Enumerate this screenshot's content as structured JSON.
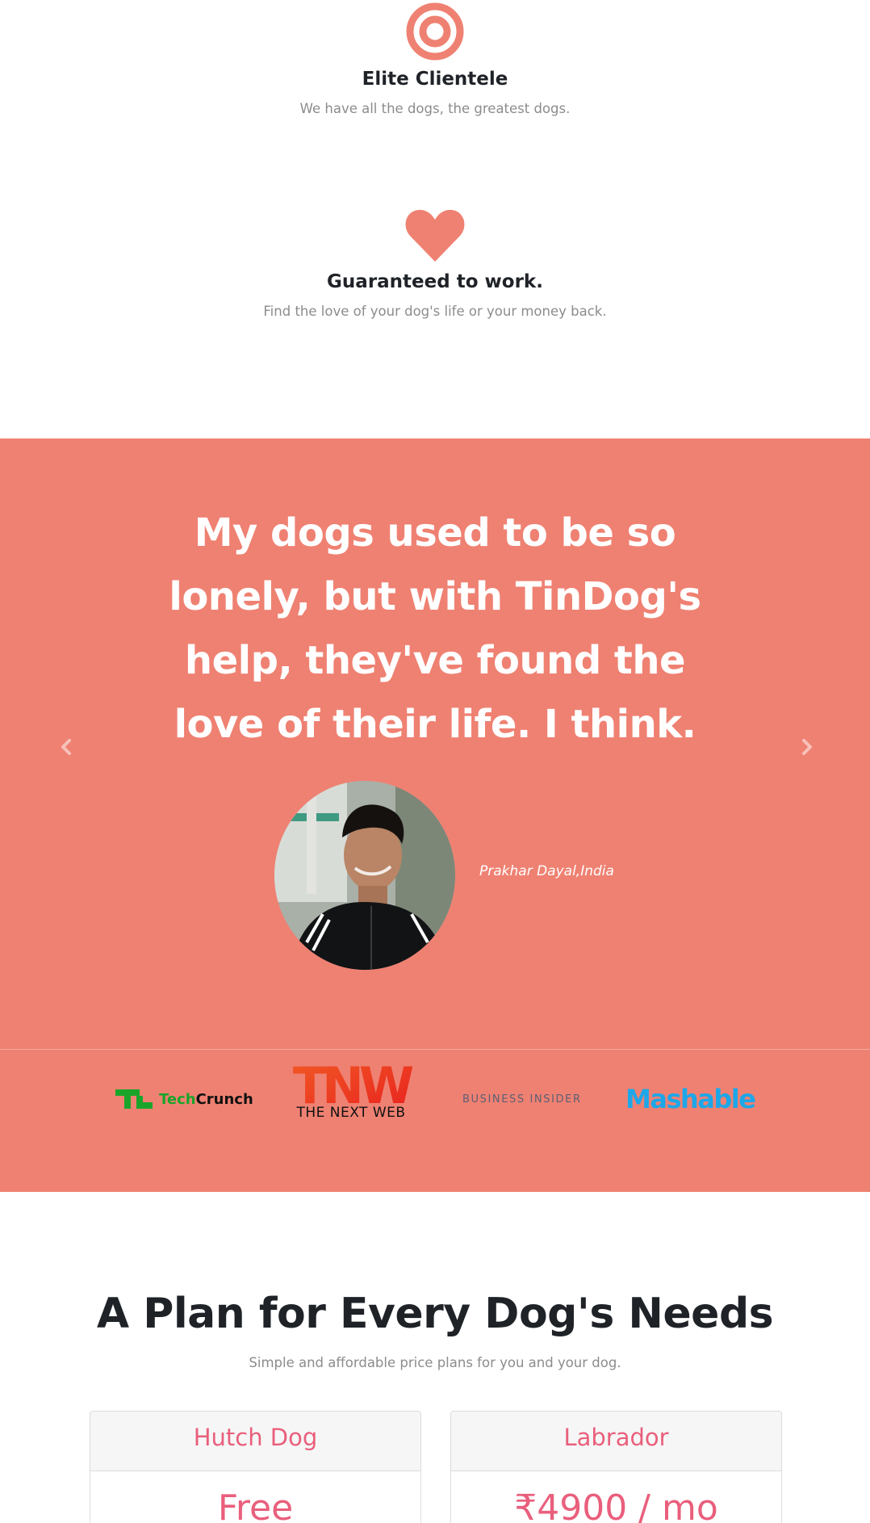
{
  "features": [
    {
      "icon": "bullseye-icon",
      "title": "Elite Clientele",
      "text": "We have all the dogs, the greatest dogs."
    },
    {
      "icon": "heart-icon",
      "title": "Guaranteed to work.",
      "text": "Find the love of your dog's life or your money back."
    }
  ],
  "testimonial": {
    "quote": "My dogs used to be so lonely, but with TinDog's help, they've found the love of their life. I think.",
    "author": "Prakhar Dayal,India",
    "prev_icon": "chevron-left-icon",
    "next_icon": "chevron-right-icon"
  },
  "press": {
    "techcrunch": {
      "tech": "Tech",
      "crunch": "Crunch"
    },
    "tnw": {
      "mark": "TNW",
      "caption": "THE NEXT WEB"
    },
    "business_insider": "BUSINESS INSIDER",
    "mashable": "Mashable"
  },
  "pricing": {
    "title": "A Plan for Every Dog's Needs",
    "subtitle": "Simple and affordable price plans for you and your dog.",
    "plans": [
      {
        "name": "Hutch Dog",
        "price": "Free"
      },
      {
        "name": "Labrador",
        "price": "₹4900 / mo"
      }
    ]
  },
  "colors": {
    "accent": "#ef8172",
    "plan_text": "#e95f7c",
    "tc_green": "#1aa52a",
    "mashable_blue": "#1ea7e8"
  }
}
